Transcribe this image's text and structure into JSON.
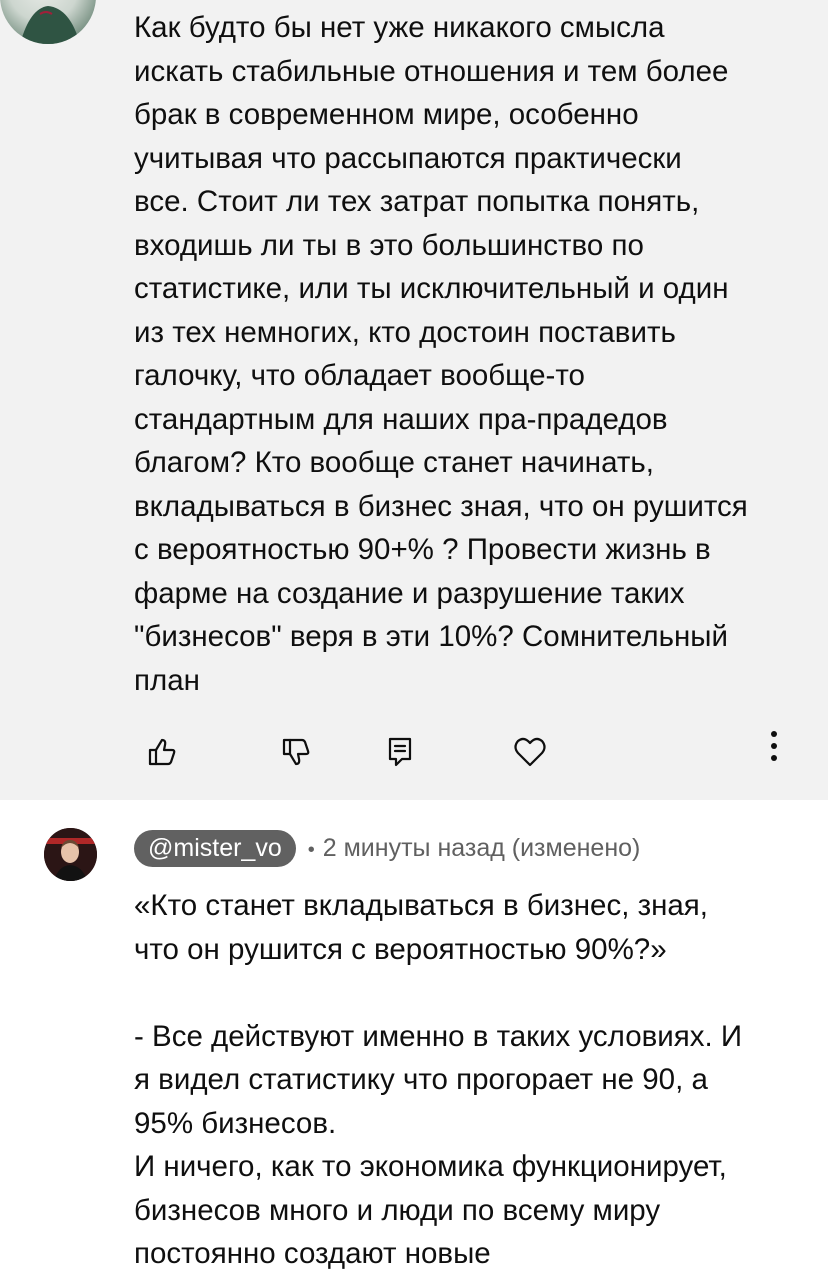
{
  "comments": [
    {
      "text": "Как будто бы нет уже никакого смысла\nискать стабильные отношения и тем более\nбрак в современном мире, особенно\nучитывая что рассыпаются практически\nвсе. Стоит ли тех затрат попытка понять,\nвходишь ли ты в это большинство по\nстатистике, или ты исключительный и один\nиз тех немногих, кто достоин поставить\nгалочку, что обладает вообще-то\nстандартным для наших пра-прадедов\nблагом? Кто вообще станет начинать,\nвкладываться в бизнес зная, что он рушится\nс вероятностью 90+% ? Провести жизнь в\nфарме на создание и разрушение таких\n\"бизнесов\" веря в эти 10%? Сомнительный\nплан",
      "actions": {
        "like_icon": "thumbs-up-icon",
        "dislike_icon": "thumbs-down-icon",
        "reply_icon": "reply-comment-icon",
        "heart_icon": "heart-icon",
        "more_icon": "more-vertical-icon"
      }
    },
    {
      "author": "@mister_vo",
      "separator": "•",
      "timestamp": "2 минуты назад (изменено)",
      "text": "«Кто станет вкладываться в бизнес, зная,\nчто он рушится с вероятностью 90%?»\n\n- Все действуют именно в таких условиях. И\nя видел статистику что прогорает не 90, а\n95% бизнесов.\nИ ничего, как то экономика функционирует,\nбизнесов много и люди по всему миру\nпостоянно создают новые"
    }
  ],
  "colors": {
    "highlight_bg": "#f2f2f2",
    "chip_bg": "#616161",
    "meta_text": "#606060",
    "text": "#0f0f0f"
  }
}
